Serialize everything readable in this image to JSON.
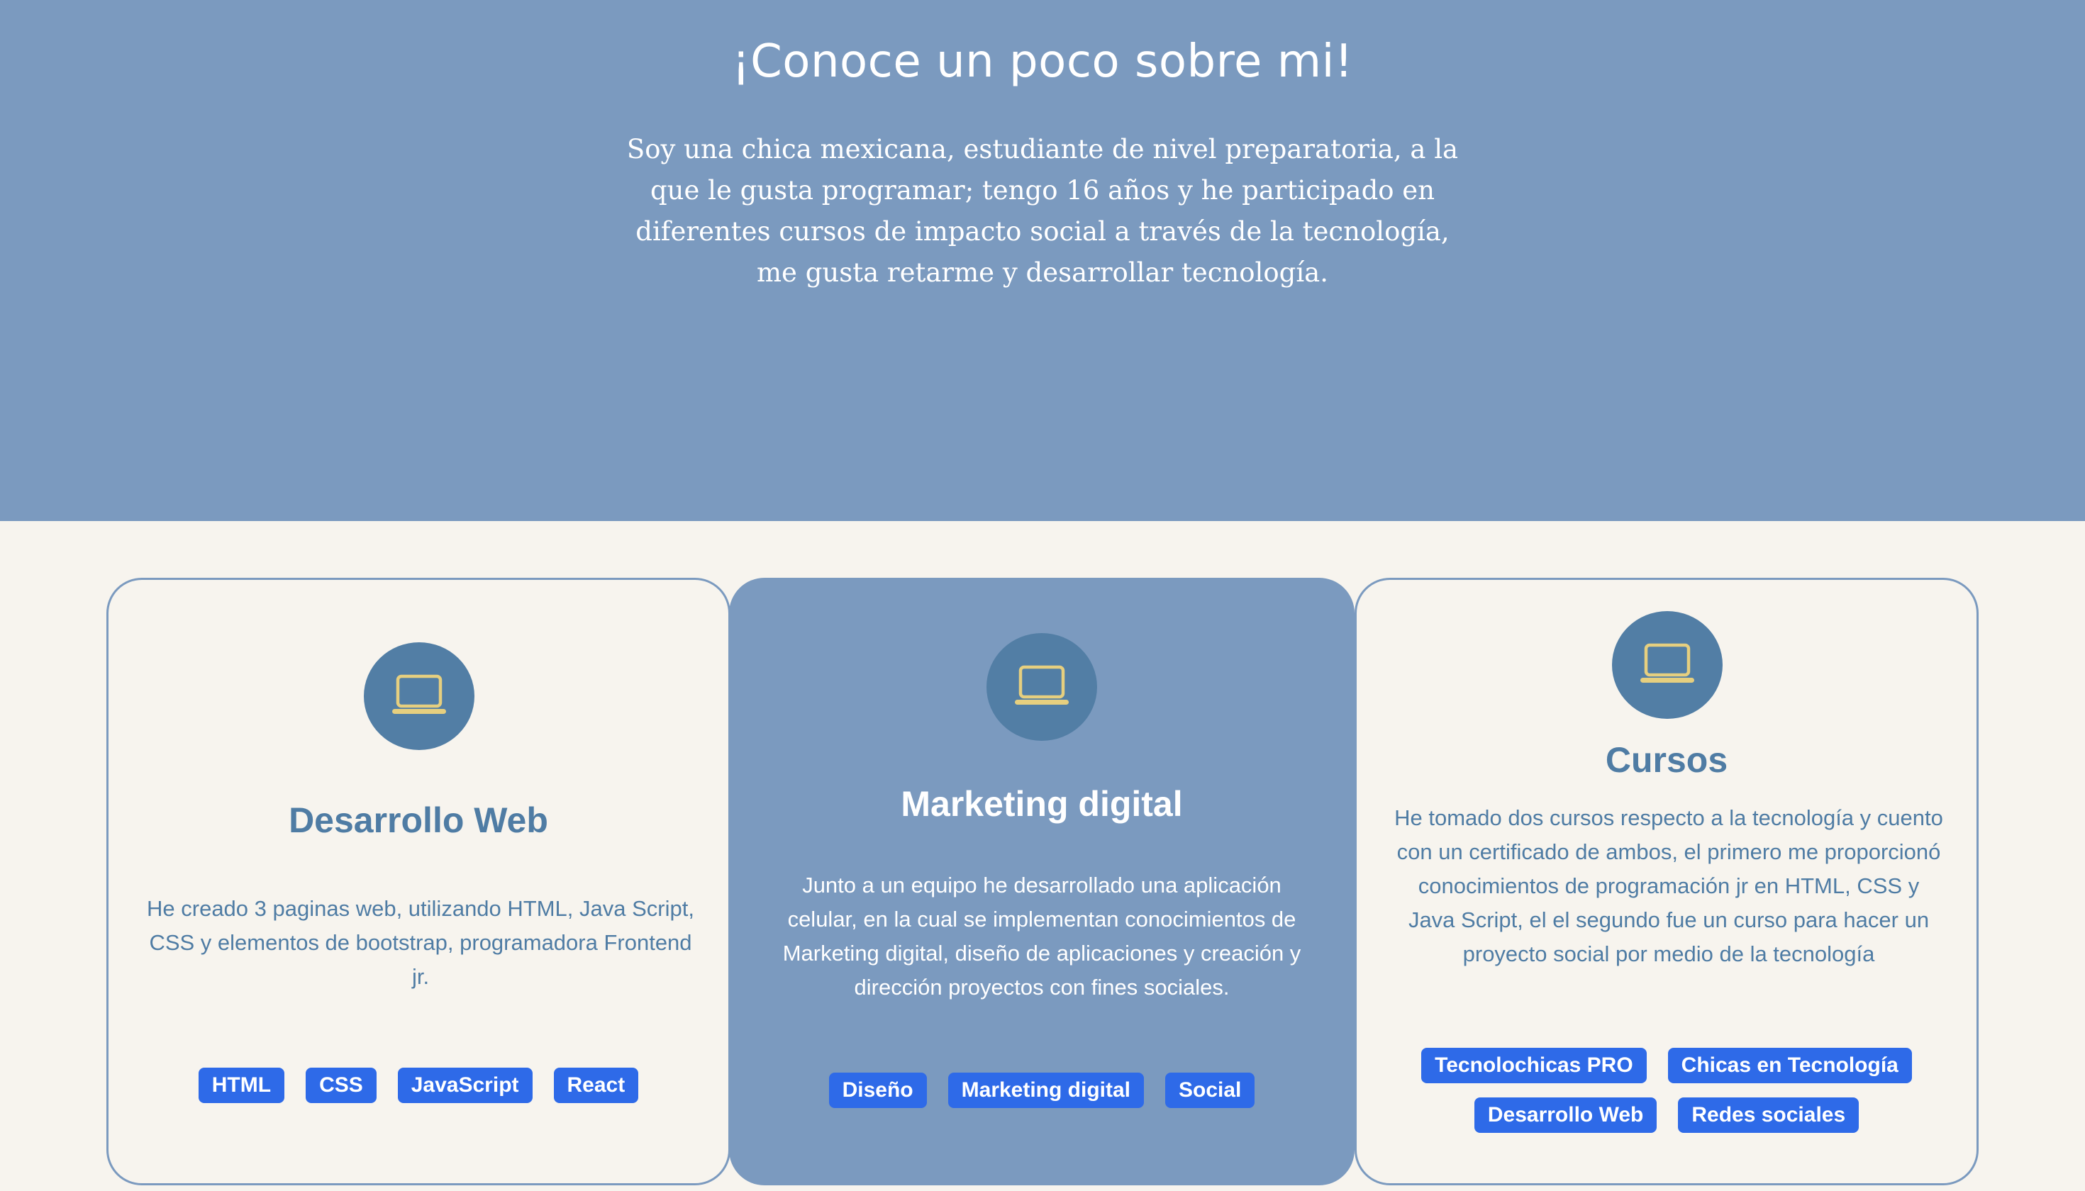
{
  "hero": {
    "title": "¡Conoce un poco sobre mi!",
    "text": "Soy una chica mexicana, estudiante de nivel preparatoria, a la que le gusta programar; tengo 16 años y he participado en diferentes cursos de impacto social a través de la tecnología, me gusta retarme y desarrollar tecnología."
  },
  "cards": [
    {
      "icon": "laptop-icon",
      "title": "Desarrollo Web",
      "text": "He creado 3 paginas web, utilizando HTML, Java Script, CSS y elementos de bootstrap, programadora Frontend jr.",
      "tags": [
        "HTML",
        "CSS",
        "JavaScript",
        "React"
      ]
    },
    {
      "icon": "laptop-icon",
      "title": "Marketing digital",
      "text": "Junto a un equipo he desarrollado una aplicación celular, en la cual se implementan conocimientos de Marketing digital, diseño de aplicaciones y creación y dirección proyectos con fines sociales.",
      "tags": [
        "Diseño",
        "Marketing digital",
        "Social"
      ]
    },
    {
      "icon": "laptop-icon",
      "title": "Cursos",
      "text": "He tomado dos cursos respecto a la tecnología y cuento con un certificado de ambos, el primero me proporcionó conocimientos de programación jr en HTML, CSS y Java Script, el el segundo fue un curso para hacer un proyecto social por medio de la tecnología",
      "tags": [
        "Tecnolochicas PRO",
        "Chicas en Tecnología",
        "Desarrollo Web",
        "Redes sociales"
      ]
    }
  ],
  "colors": {
    "hero_bg": "#7b9abf",
    "page_bg": "#f7f4ee",
    "accent_text": "#4f7ca4",
    "icon_circle": "#527ea5",
    "icon_stroke": "#e6cf7f",
    "tag_bg": "#2e6ae8"
  }
}
